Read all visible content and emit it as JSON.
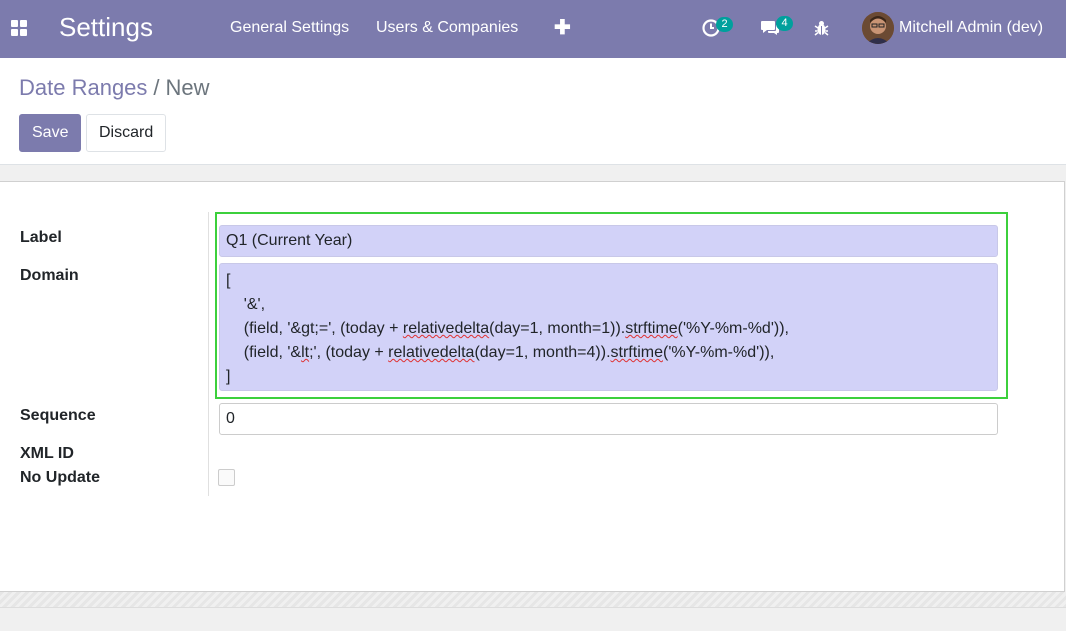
{
  "navbar": {
    "brand": "Settings",
    "menu": [
      "General Settings",
      "Users & Companies"
    ],
    "activities_badge": "2",
    "messages_badge": "4",
    "user_name": "Mitchell Admin (dev)"
  },
  "breadcrumb": {
    "parent": "Date Ranges",
    "separator": "/",
    "current": "New"
  },
  "buttons": {
    "save": "Save",
    "discard": "Discard"
  },
  "form": {
    "label_label": "Label",
    "label_value": "Q1 (Current Year)",
    "domain_label": "Domain",
    "domain_lines": {
      "l1": "[",
      "l2": "'&',",
      "l3_a": "(field, '&gt;=', (today + ",
      "l3_b": "relativedelta",
      "l3_c": "(day=1, month=1)).",
      "l3_d": "strftime",
      "l3_e": "('%Y-%m-%d')),",
      "l4_a": "(field, '&",
      "l4_b": "lt",
      "l4_c": ";', (today + ",
      "l4_d": "relativedelta",
      "l4_e": "(day=1, month=4)).",
      "l4_f": "strftime",
      "l4_g": "('%Y-%m-%d')),",
      "l5": "]"
    },
    "sequence_label": "Sequence",
    "sequence_value": "0",
    "xmlid_label": "XML ID",
    "noupdate_label": "No Update"
  },
  "colors": {
    "navbar": "#7c7bad",
    "badge": "#00a09d",
    "highlight": "#3cd03c",
    "field_bg": "#d2d2f8"
  },
  "icons": [
    "apps-icon",
    "plus-icon",
    "activity-clock-icon",
    "chat-icon",
    "bug-icon",
    "avatar"
  ]
}
